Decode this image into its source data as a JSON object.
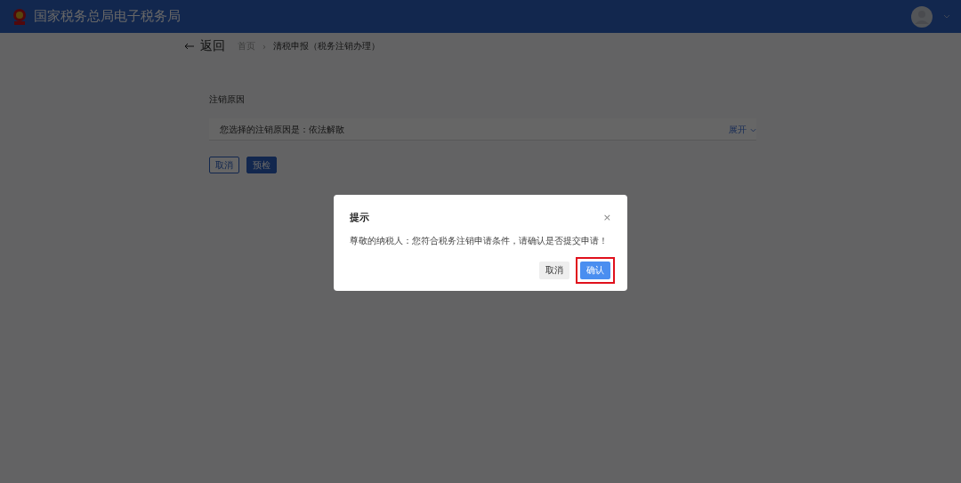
{
  "header": {
    "title": "国家税务总局电子税务局"
  },
  "breadcrumb": {
    "back": "返回",
    "items": [
      {
        "label": "首页",
        "current": false
      },
      {
        "label": "清税申报（税务注销办理）",
        "current": true
      }
    ],
    "separator": "›"
  },
  "form": {
    "section_title": "注销原因",
    "reason_text": "您选择的注销原因是：依法解散",
    "expand_link": "展开",
    "buttons": [
      {
        "label": "取消",
        "kind": "secondary"
      },
      {
        "label": "预检",
        "kind": "primary"
      }
    ]
  },
  "dialog": {
    "title": "提示",
    "close": "×",
    "message": "尊敬的纳税人：您符合税务注销申请条件，请确认是否提交申请！",
    "buttons": [
      {
        "label": "取消",
        "kind": "secondary",
        "highlighted": false
      },
      {
        "label": "确认",
        "kind": "primary",
        "highlighted": true
      }
    ]
  }
}
